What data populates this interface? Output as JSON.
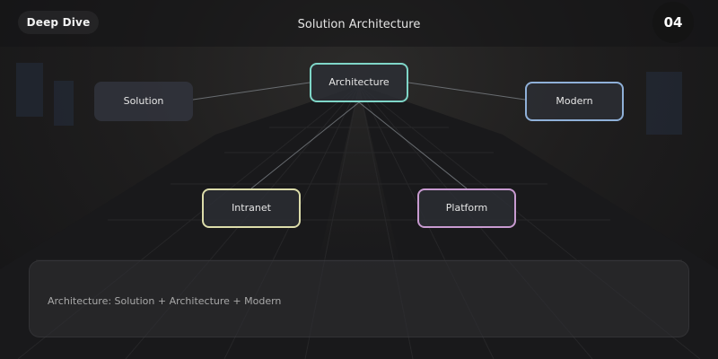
{
  "header": {
    "section_label": "Deep Dive",
    "title": "Solution Architecture",
    "page_number": "04"
  },
  "diagram": {
    "nodes": [
      {
        "id": "solution",
        "label": "Solution"
      },
      {
        "id": "architecture",
        "label": "Architecture",
        "border_color": "#7fd6c8"
      },
      {
        "id": "modern",
        "label": "Modern",
        "border_color": "#8fb0d8"
      },
      {
        "id": "intranet",
        "label": "Intranet",
        "border_color": "#dcdcaa"
      },
      {
        "id": "platform",
        "label": "Platform",
        "border_color": "#c89ad0"
      }
    ],
    "edges": [
      {
        "from": "architecture",
        "to": "solution"
      },
      {
        "from": "architecture",
        "to": "modern"
      },
      {
        "from": "architecture",
        "to": "intranet"
      },
      {
        "from": "architecture",
        "to": "platform"
      }
    ]
  },
  "summary": {
    "text": "Architecture: Solution + Architecture + Modern"
  }
}
